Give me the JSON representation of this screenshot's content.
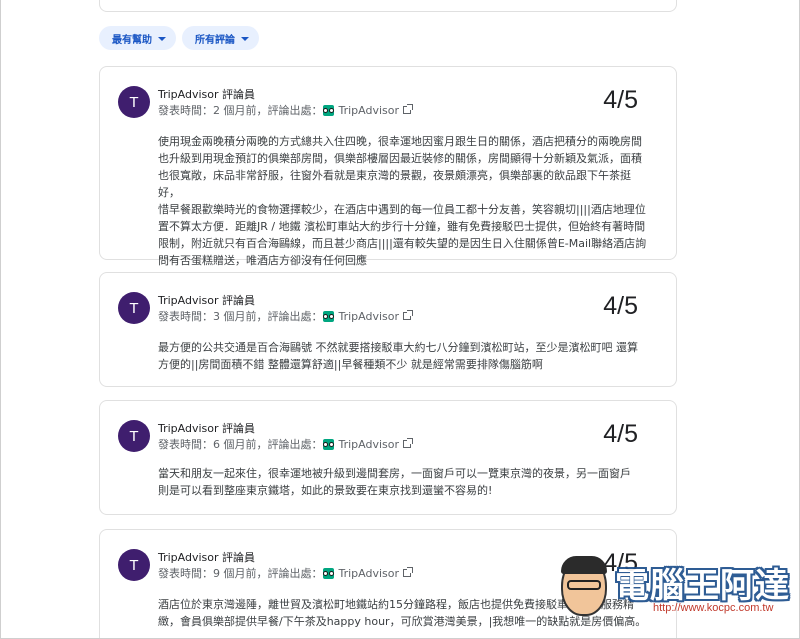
{
  "filters": {
    "sort_label": "最有幫助",
    "source_label": "所有評論"
  },
  "reviews": [
    {
      "initial": "T",
      "author": "TripAdvisor 評論員",
      "time": "發表時間：2 個月前，",
      "source_prefix": "評論出處：",
      "source": "TripAdvisor",
      "rating": "4/5",
      "lines": [
        "使用現金兩晚積分兩晚的方式總共入住四晚，很幸運地因蜜月跟生日的關係，酒店把積分的兩晚房間",
        "也升級到用現金預訂的俱樂部房間，俱樂部樓層因最近裝修的關係，房間顯得十分新穎及氣派，面積",
        "也很寬敞，床品非常舒服，往窗外看就是東京灣的景觀，夜景頗漂亮，俱樂部裏的飲品跟下午茶挺好，",
        "惜早餐跟歡樂時光的食物選擇較少，在酒店中遇到的每一位員工都十分友善，笑容親切||||酒店地理位",
        "置不算太方便．距離JR / 地鐵 濱松町車站大約步行十分鐘，雖有免費接駁巴士提供，但始終有著時間",
        "限制，附近就只有百合海鷗線，而且甚少商店||||還有較失望的是因生日入住關係曾E-Mail聯絡酒店詢",
        "問有否蛋糕贈送，唯酒店方卻沒有任何回應"
      ]
    },
    {
      "initial": "T",
      "author": "TripAdvisor 評論員",
      "time": "發表時間：3 個月前，",
      "source_prefix": "評論出處：",
      "source": "TripAdvisor",
      "rating": "4/5",
      "lines": [
        "最方便的公共交通是百合海鷗號 不然就要搭接駁車大約七八分鐘到濱松町站，至少是濱松町吧 還算",
        "方便的||房間面積不錯 整體還算舒適||早餐種類不少 就是經常需要排隊傷腦筋啊"
      ]
    },
    {
      "initial": "T",
      "author": "TripAdvisor 評論員",
      "time": "發表時間：6 個月前，",
      "source_prefix": "評論出處：",
      "source": "TripAdvisor",
      "rating": "4/5",
      "lines": [
        "當天和朋友一起來住，很幸運地被升級到邊間套房，一面窗戶可以一覽東京灣的夜景，另一面窗戶",
        "則是可以看到整座東京鐵塔，如此的景致要在東京找到還蠻不容易的!"
      ]
    },
    {
      "initial": "T",
      "author": "TripAdvisor 評論員",
      "time": "發表時間：9 個月前，",
      "source_prefix": "評論出處：",
      "source": "TripAdvisor",
      "rating": "4/5",
      "lines": [
        "酒店位於東京灣邊陲，離世貿及濱松町地鐵站約15分鐘路程，飯店也提供免費接駁車，飯店服務精",
        "緻，會員俱樂部提供早餐/下午茶及happy hour，可欣賞港灣美景，|我想唯一的缺點就是房價偏高。"
      ]
    }
  ],
  "watermark": {
    "title": "電腦王阿達",
    "url": "http://www.kocpc.com.tw"
  }
}
